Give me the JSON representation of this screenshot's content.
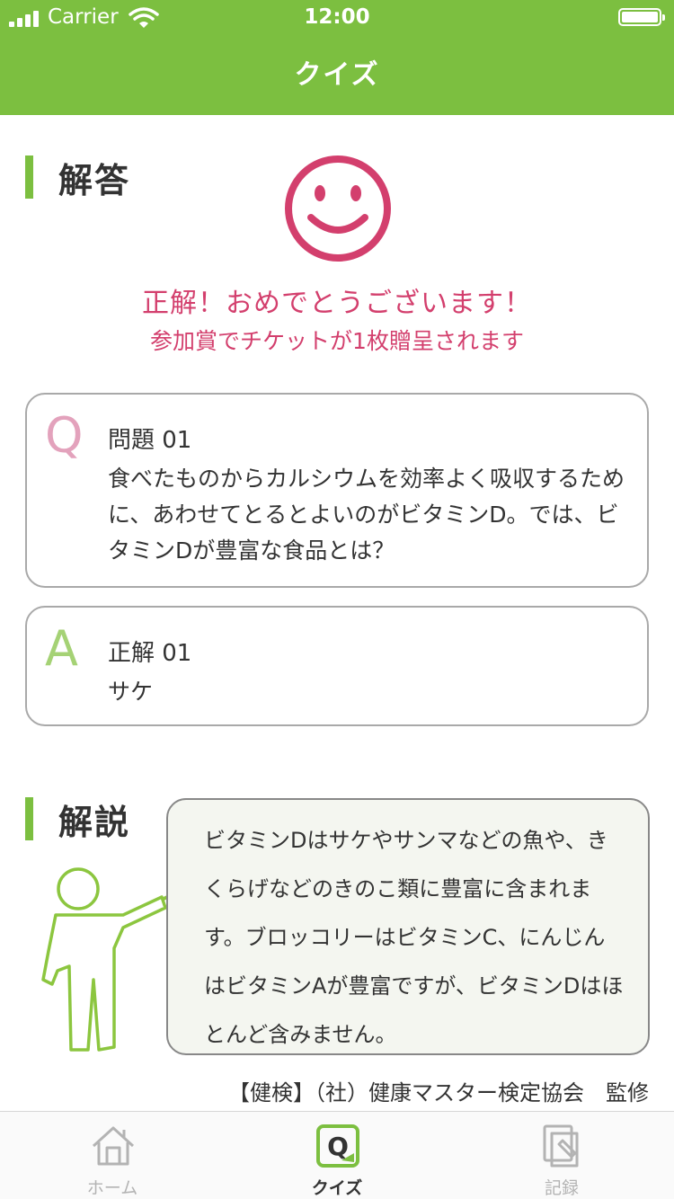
{
  "status_bar": {
    "carrier": "Carrier",
    "time": "12:00"
  },
  "header": {
    "title": "クイズ"
  },
  "answer_section": {
    "title": "解答",
    "result_main": "正解！おめでとうございます！",
    "result_sub": "参加賞でチケットが1枚贈呈されます",
    "result_color": "#d33f6d"
  },
  "question_card": {
    "letter": "Q",
    "label": "問題 01",
    "text": "食べたものからカルシウムを効率よく吸収するために、あわせてとるとよいのがビタミンD。では、ビタミンDが豊富な食品とは？"
  },
  "answer_card": {
    "letter": "A",
    "label": "正解 01",
    "text": "サケ"
  },
  "explanation_section": {
    "title": "解説",
    "text": "ビタミンDはサケやサンマなどの魚や、きくらげなどのきのこ類に豊富に含まれます。ブロッコリーはビタミンC、にんじんはビタミンAが豊富ですが、ビタミンDはほとんど含みません。",
    "credit": "【健検】（社）健康マスター検定協会　監修"
  },
  "tab_bar": {
    "home_label": "ホーム",
    "quiz_label": "クイズ",
    "log_label": "記録",
    "active_tab": "quiz"
  },
  "colors": {
    "brand_green": "#7cbf40",
    "accent_pink": "#d33f6d"
  }
}
